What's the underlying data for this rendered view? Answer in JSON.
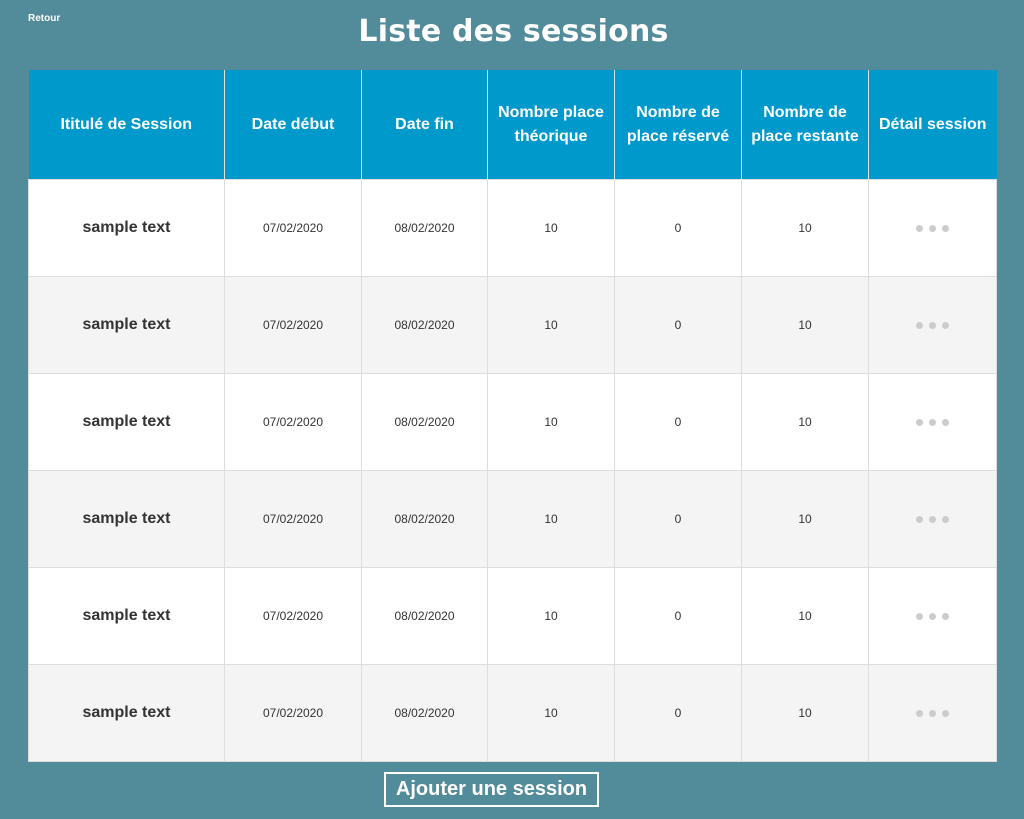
{
  "nav": {
    "back_label": "Retour"
  },
  "page": {
    "title": "Liste des sessions"
  },
  "table": {
    "headers": [
      "Ititulé de Session",
      "Date début",
      "Date fin",
      "Nombre place théorique",
      "Nombre de place réservé",
      "Nombre de place restante",
      "Détail session"
    ],
    "rows": [
      {
        "name": "sample text",
        "start": "07/02/2020",
        "end": "08/02/2020",
        "theoretical": "10",
        "reserved": "0",
        "remaining": "10",
        "detail_icon": "more-dots-icon"
      },
      {
        "name": "sample text",
        "start": "07/02/2020",
        "end": "08/02/2020",
        "theoretical": "10",
        "reserved": "0",
        "remaining": "10",
        "detail_icon": "more-dots-icon"
      },
      {
        "name": "sample text",
        "start": "07/02/2020",
        "end": "08/02/2020",
        "theoretical": "10",
        "reserved": "0",
        "remaining": "10",
        "detail_icon": "more-dots-icon"
      },
      {
        "name": "sample text",
        "start": "07/02/2020",
        "end": "08/02/2020",
        "theoretical": "10",
        "reserved": "0",
        "remaining": "10",
        "detail_icon": "more-dots-icon"
      },
      {
        "name": "sample text",
        "start": "07/02/2020",
        "end": "08/02/2020",
        "theoretical": "10",
        "reserved": "0",
        "remaining": "10",
        "detail_icon": "more-dots-icon"
      },
      {
        "name": "sample text",
        "start": "07/02/2020",
        "end": "08/02/2020",
        "theoretical": "10",
        "reserved": "0",
        "remaining": "10",
        "detail_icon": "more-dots-icon"
      }
    ]
  },
  "actions": {
    "add_label": "Ajouter une session"
  },
  "colors": {
    "background": "#528b99",
    "header": "#0099cc",
    "row_alt": "#f4f4f4",
    "dots": "#cccccc"
  }
}
